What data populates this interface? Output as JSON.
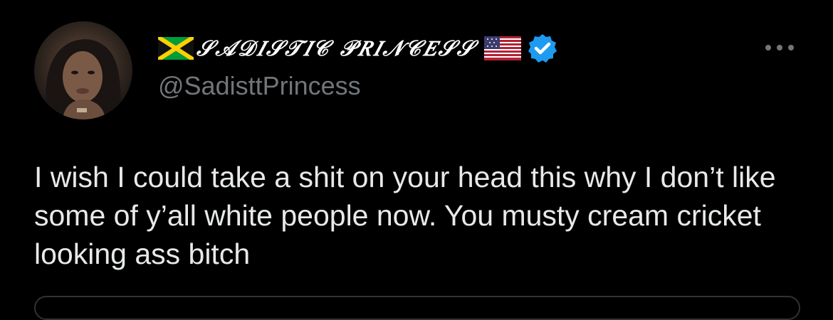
{
  "tweet": {
    "display_name": "𝒮𝒜𝒟𝐼𝒮𝒯𝐼𝒞 𝒫𝑅𝐼𝒩𝒞𝐸𝒮𝒮",
    "handle": "@SadisttPrincess",
    "verified": true,
    "text": "I wish I could take a shit on your head this why I don’t like some of y’all white people now. You musty cream cricket looking ass bitch"
  },
  "colors": {
    "background": "#000000",
    "name": "#ffffff",
    "handle": "#71767b",
    "text": "#e7e9ea",
    "verified_badge": "#1d9bf0"
  },
  "icons": {
    "left_flag": "jamaica-flag-icon",
    "right_flag": "us-flag-icon",
    "badge": "verified-badge-icon",
    "menu": "more-options-icon"
  }
}
